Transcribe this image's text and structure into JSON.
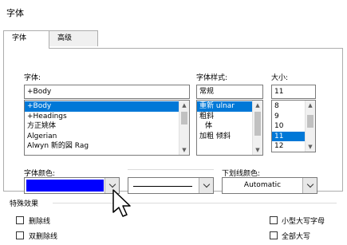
{
  "window": {
    "title": "字体"
  },
  "tabs": [
    {
      "label": "字体",
      "active": true
    },
    {
      "label": "高级",
      "active": false
    }
  ],
  "font": {
    "label": "字体:",
    "value": "+Body",
    "items": [
      "+Body",
      "+Headings",
      "方正姚体",
      "Algerian",
      "Alwyn 新的図 Rag"
    ],
    "selected_index": 0
  },
  "style": {
    "label": "字体样式:",
    "value": "常规",
    "items": [
      "重新 ulnar",
      "粗斜",
      "体",
      "加粗 倾斜"
    ],
    "selected_index": 0
  },
  "size": {
    "label": "大小:",
    "value": "11",
    "items": [
      "8",
      "9",
      "10",
      "11",
      "12"
    ],
    "selected_index": 3
  },
  "font_color": {
    "label": "字体颜色:",
    "color": "#0000ff"
  },
  "underline_style": {
    "label": ""
  },
  "underline_color": {
    "label": "下划线颜色:",
    "value": "Automatic"
  },
  "effects": {
    "label": "特殊效果",
    "strikethrough": "删除线",
    "double_strikethrough": "双删除线",
    "small_caps": "小型大写字母",
    "all_caps": "全部大写"
  },
  "colors": {
    "selection": "#0078d7",
    "swatch": "#0000ff"
  },
  "icons": {
    "cursor": "mouse-pointer-icon",
    "dropdown": "chevron-down-icon"
  }
}
